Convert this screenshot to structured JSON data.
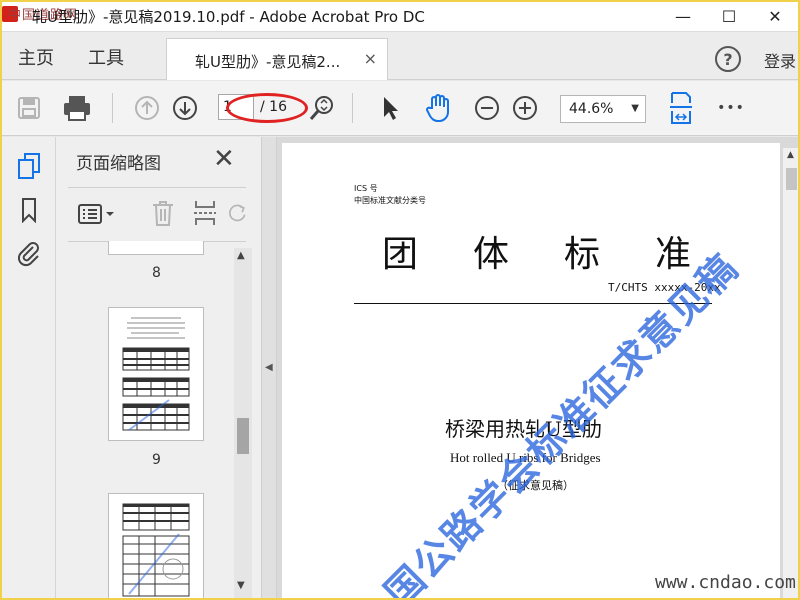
{
  "window": {
    "logo_text": "中国道路网",
    "title": "轧U型肋》-意见稿2019.10.pdf - Adobe Acrobat Pro DC",
    "minimize": "—",
    "maximize": "☐",
    "close": "✕"
  },
  "tabs": {
    "home": "主页",
    "tools": "工具",
    "document": "轧U型肋》-意见稿2...",
    "document_close": "×",
    "help": "?",
    "login": "登录"
  },
  "toolbar": {
    "page_current": "1",
    "page_total": "/ 16",
    "zoom": "44.6%",
    "more": "•••"
  },
  "thumbnails": {
    "title": "页面缩略图",
    "close": "✕",
    "pages": [
      {
        "label": "8"
      },
      {
        "label": "9"
      }
    ]
  },
  "document": {
    "ics_line1": "ICS 号",
    "ics_line2": "中国标准文献分类号",
    "title_chars": [
      "团",
      "体",
      "标",
      "准"
    ],
    "std_code": "T/CHTS xxxxx-20xx",
    "title_cn": "桥梁用热轧U型肋",
    "title_en": "Hot rolled U ribs for Bridges",
    "subtitle": "（征求意见稿）"
  },
  "watermark": "国公路学会标准征求意见稿",
  "site": "www.cndao.com",
  "colors": {
    "accent": "#1473e6",
    "annotation": "#e02222",
    "watermark": "#2864dc"
  }
}
